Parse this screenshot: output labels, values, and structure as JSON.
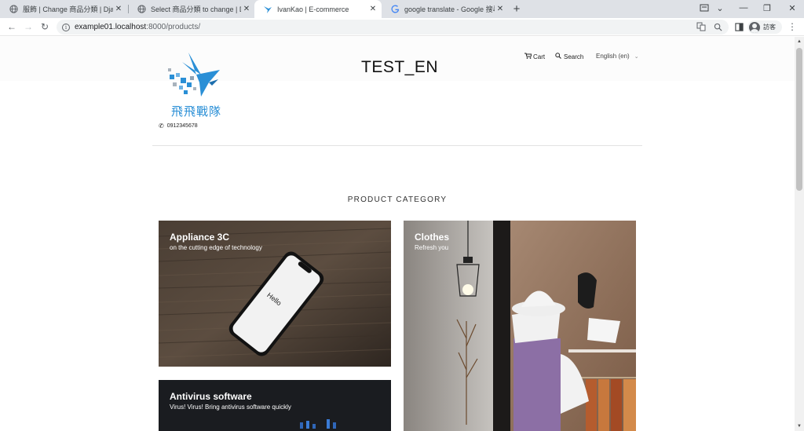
{
  "browser": {
    "tabs": [
      {
        "title": "服飾 | Change 商品分類 | Django",
        "active": false,
        "icon": "globe-icon"
      },
      {
        "title": "Select 商品分類 to change | Django",
        "active": false,
        "icon": "globe-icon"
      },
      {
        "title": "IvanKao | E-commerce",
        "active": true,
        "icon": "bird-favicon"
      },
      {
        "title": "google translate - Google 搜尋",
        "active": false,
        "icon": "google-g-icon"
      }
    ],
    "url_host": "example01.localhost",
    "url_path": ":8000/products/",
    "profile_label": "訪客"
  },
  "header": {
    "logo_text": "飛飛戰隊",
    "phone": "0912345678",
    "site_title": "TEST_EN",
    "cart_label": "Cart",
    "search_label": "Search",
    "language_label": "English (en)"
  },
  "main": {
    "section_title": "PRODUCT CATEGORY",
    "phone_screen_text": "Hello",
    "categories": [
      {
        "title": "Appliance 3C",
        "subtitle": "on the cutting edge of technology"
      },
      {
        "title": "Clothes",
        "subtitle": "Refresh you"
      },
      {
        "title": "Antivirus software",
        "subtitle": "Virus! Virus! Bring antivirus software quickly"
      }
    ]
  },
  "colors": {
    "logo_blue": "#2a8fd6",
    "tabbar_bg": "#dee1e6",
    "active_tab_bg": "#ffffff",
    "text_dark": "#111111"
  }
}
